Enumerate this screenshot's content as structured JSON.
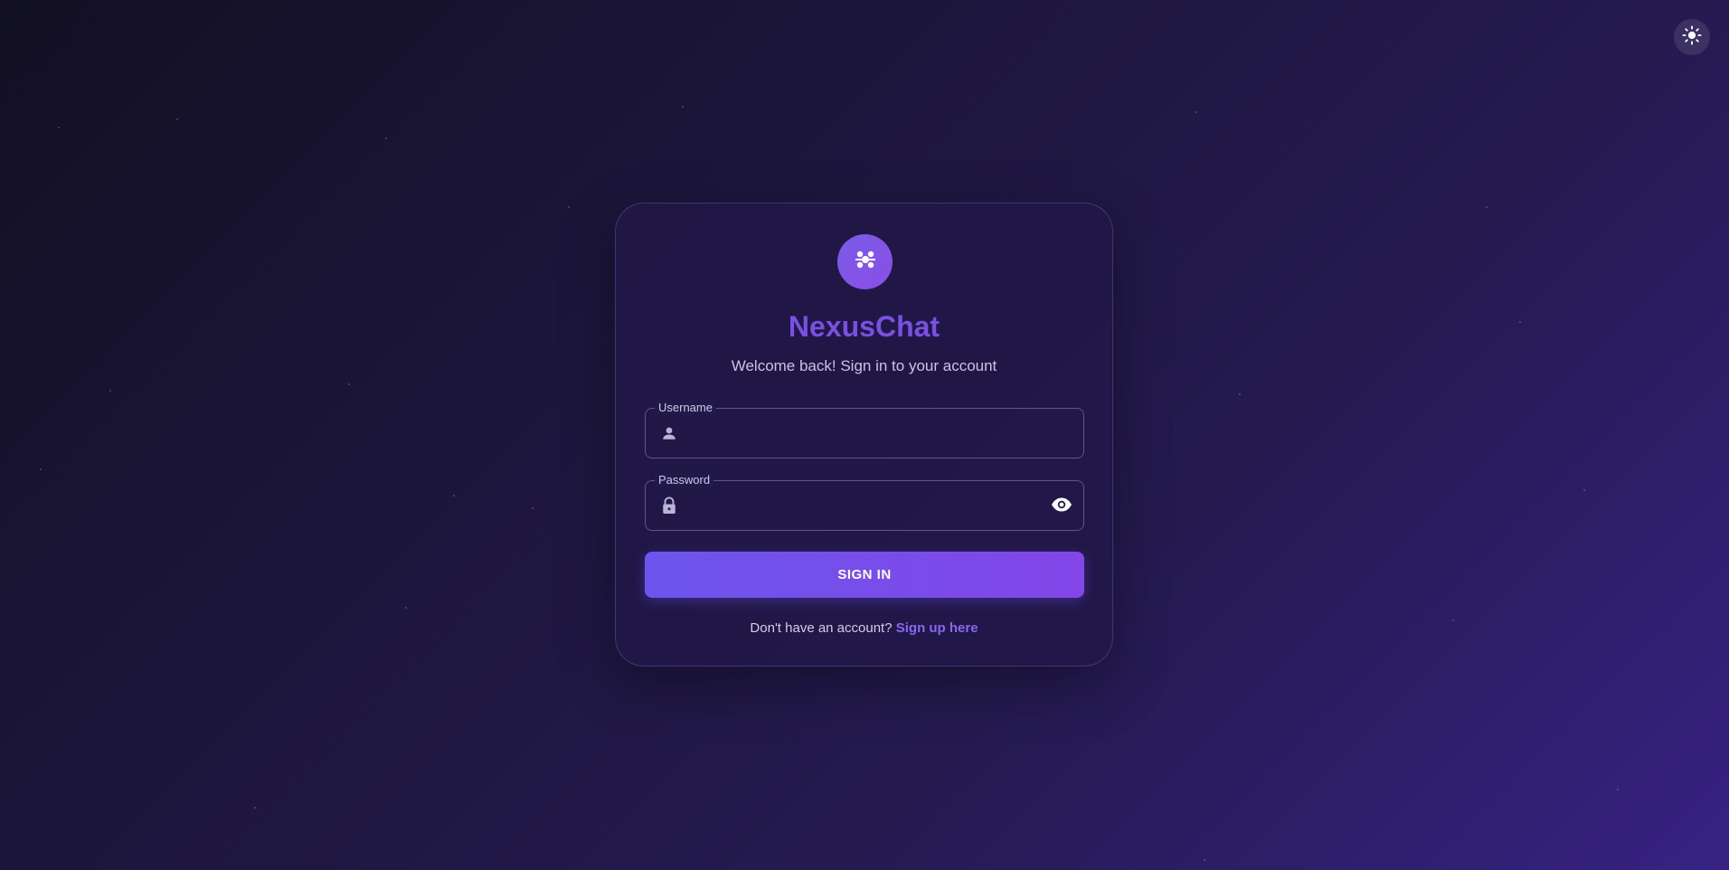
{
  "app": {
    "name": "NexusChat",
    "subtitle": "Welcome back! Sign in to your account"
  },
  "icons": {
    "theme_toggle": "sun-icon",
    "logo": "hub-icon",
    "username": "person-icon",
    "password": "lock-icon",
    "visibility": "eye-icon"
  },
  "form": {
    "username": {
      "label": "Username",
      "value": "",
      "placeholder": ""
    },
    "password": {
      "label": "Password",
      "value": "",
      "placeholder": ""
    },
    "submit_label": "SIGN IN"
  },
  "footer": {
    "prompt": "Don't have an account? ",
    "link_label": "Sign up here"
  },
  "colors": {
    "accent": "#7b4fe3",
    "button_start": "#6b55ec",
    "button_end": "#8346e8",
    "link": "#8a67f0"
  }
}
